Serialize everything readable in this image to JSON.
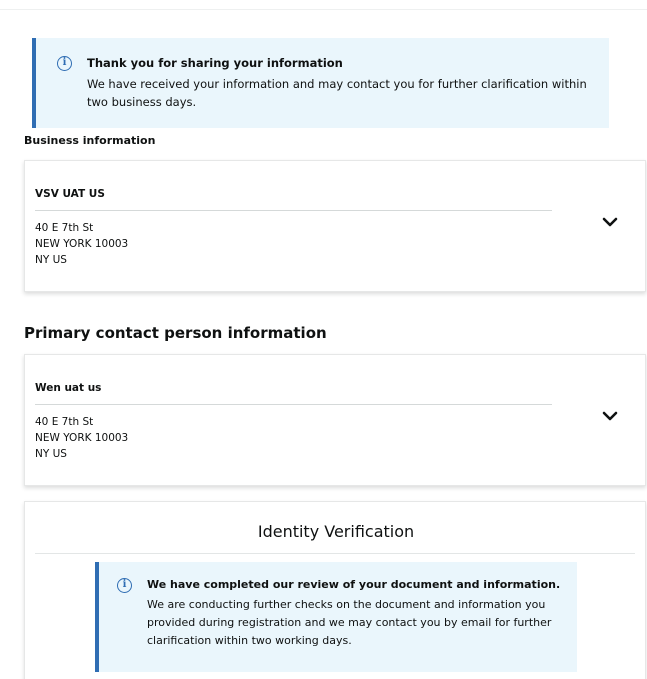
{
  "alert_top": {
    "icon": "info-icon",
    "title": "Thank you for sharing your information",
    "body": "We have received your information and may contact you for further clarification within two business days."
  },
  "business": {
    "section_label": "Business information",
    "name": "VSV UAT US",
    "address_line1": "40 E 7th St",
    "address_line2": "NEW YORK 10003",
    "address_line3": "NY US",
    "toggle_icon": "chevron-down-icon"
  },
  "contact": {
    "section_heading": "Primary contact person information",
    "name": "Wen uat us",
    "address_line1": "40 E 7th St",
    "address_line2": "NEW YORK 10003",
    "address_line3": "NY US",
    "toggle_icon": "chevron-down-icon"
  },
  "identity": {
    "title": "Identity Verification",
    "alert": {
      "icon": "info-icon",
      "title": "We have completed our review of your document and information.",
      "body": "We are conducting further checks on the document and information you provided during registration and we may contact you by email for further clarification within two working days."
    }
  },
  "colors": {
    "alert_background": "#eaf6fc",
    "alert_accent": "#2f6db3",
    "text": "#0f1111"
  }
}
